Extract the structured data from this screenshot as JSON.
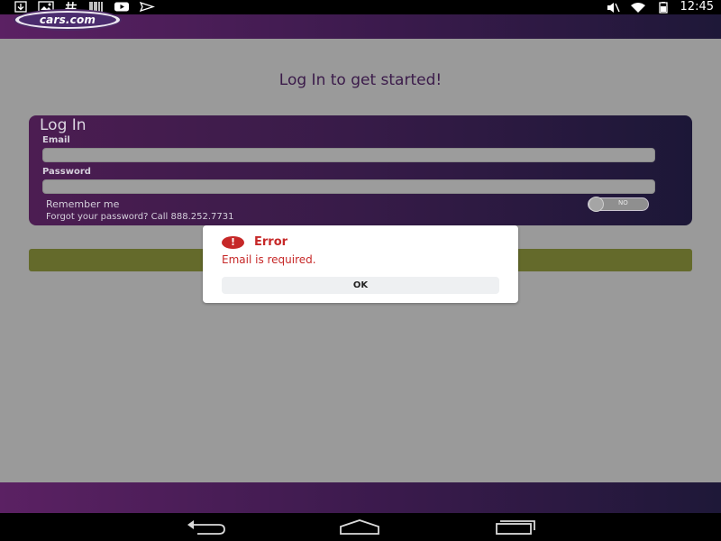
{
  "status_bar": {
    "time": "12:45",
    "left_icons": [
      "download-icon",
      "image-notification-icon",
      "hash-icon",
      "barcode-icon",
      "youtube-icon",
      "send-icon"
    ],
    "right_icons": [
      "mute-icon",
      "wifi-icon",
      "battery-icon"
    ]
  },
  "header": {
    "logo_text": "cars.com"
  },
  "main": {
    "page_title": "Log In to get started!",
    "login_card": {
      "title": "Log In",
      "email_label": "Email",
      "email_value": "",
      "password_label": "Password",
      "password_value": "",
      "remember_label": "Remember me",
      "remember_toggle": "NO",
      "forgot_text": "Forgot your password? Call 888.252.7731"
    }
  },
  "dialog": {
    "icon": "error-icon",
    "icon_glyph": "!",
    "title": "Error",
    "message": "Email is required.",
    "ok_label": "OK"
  },
  "nav_bar": {
    "buttons": [
      "back-icon",
      "home-icon",
      "recent-apps-icon"
    ]
  },
  "colors": {
    "accent_purple": "#5b2163",
    "accent_dark": "#1e1838",
    "error_red": "#c62828",
    "submit_olive": "#646a2b"
  }
}
